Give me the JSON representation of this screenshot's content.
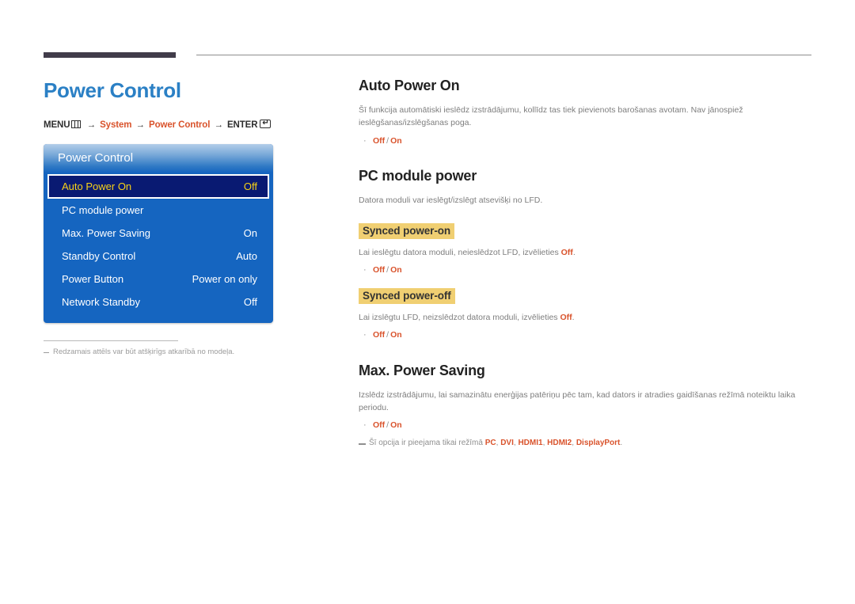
{
  "page": {
    "title": "Power Control",
    "title_color": "#2b80c5"
  },
  "breadcrumb": {
    "menu_label": "MENU",
    "menu_icon": "menu-grid-icon",
    "arrow": "→",
    "step_system": "System",
    "step_power_control": "Power Control",
    "enter_label": "ENTER",
    "enter_icon": "enter-key-icon"
  },
  "osd": {
    "header": "Power Control",
    "rows": [
      {
        "label": "Auto Power On",
        "value": "Off",
        "selected": true
      },
      {
        "label": "PC module power",
        "value": "",
        "selected": false
      },
      {
        "label": "Max. Power Saving",
        "value": "On",
        "selected": false
      },
      {
        "label": "Standby Control",
        "value": "Auto",
        "selected": false
      },
      {
        "label": "Power Button",
        "value": "Power on only",
        "selected": false
      },
      {
        "label": "Network Standby",
        "value": "Off",
        "selected": false
      }
    ],
    "selected_bg": "#091a72",
    "selected_text": "#f7d117",
    "panel_bg": "#1565c0"
  },
  "left_note": "Redzamais attēls var būt atšķirīgs atkarībā no modeļa.",
  "sections": {
    "auto_power_on": {
      "title": "Auto Power On",
      "desc": "Šī funkcija automātiski ieslēdz izstrādājumu, kollīdz tas tiek pievienots barošanas avotam. Nav jānospiež ieslēgšanas/izslēgšanas poga.",
      "opt_off": "Off",
      "opt_on": "On"
    },
    "pc_module_power": {
      "title": "PC module power",
      "desc": "Datora moduli var ieslēgt/izslēgt atsevišķi no LFD.",
      "synced_power_on": {
        "heading": "Synced power-on",
        "desc_before": "Lai ieslēgtu datora moduli, neieslēdzot LFD, izvēlieties ",
        "desc_strong": "Off",
        "desc_after": ".",
        "opt_off": "Off",
        "opt_on": "On"
      },
      "synced_power_off": {
        "heading": "Synced power-off",
        "desc_before": "Lai izslēgtu LFD, neizslēdzot datora moduli, izvēlieties ",
        "desc_strong": "Off",
        "desc_after": ".",
        "opt_off": "Off",
        "opt_on": "On"
      }
    },
    "max_power_saving": {
      "title": "Max. Power Saving",
      "desc": "Izslēdz izstrādājumu, lai samazinātu enerģijas patēriņu pēc tam, kad dators ir atradies gaidīšanas režīmā noteiktu laika periodu.",
      "opt_off": "Off",
      "opt_on": "On",
      "footnote_before": "Šī opcija ir pieejama tikai režīmā ",
      "footnote_modes": [
        "PC",
        "DVI",
        "HDMI1",
        "HDMI2",
        "DisplayPort"
      ],
      "footnote_after": "."
    }
  }
}
